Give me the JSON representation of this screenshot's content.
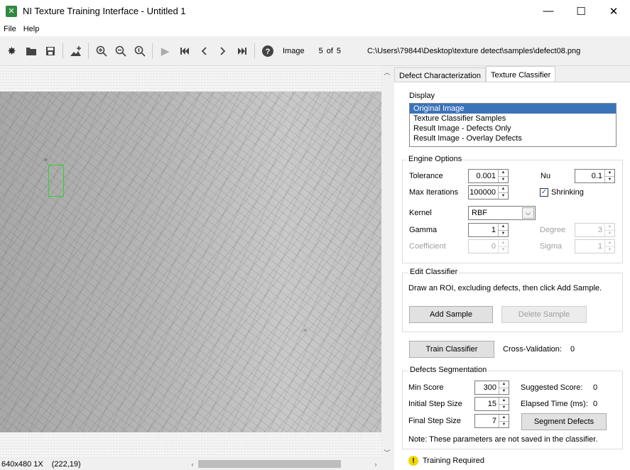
{
  "window": {
    "title": "NI Texture Training Interface - Untitled 1",
    "minimize": "—",
    "maximize": "☐",
    "close": "✕"
  },
  "menu": {
    "items": [
      {
        "label": "File"
      },
      {
        "label": "Help"
      }
    ]
  },
  "toolbar": {
    "image_label": "Image",
    "image_index": "5",
    "of_text": "of",
    "image_count": "5",
    "file_path": "C:\\Users\\79844\\Desktop\\texture detect\\samples\\defect08.png"
  },
  "status": {
    "image_info": "640x480 1X",
    "coords": "(222,19)"
  },
  "tabs": [
    {
      "label": "Defect Characterization",
      "active": false
    },
    {
      "label": "Texture Classifier",
      "active": true
    }
  ],
  "display": {
    "section_label": "Display",
    "options": [
      "Original Image",
      "Texture Classifier Samples",
      "Result Image - Defects Only",
      "Result Image - Overlay Defects"
    ],
    "selected": "Original Image"
  },
  "engine": {
    "section_label": "Engine Options",
    "tolerance_label": "Tolerance",
    "tolerance": "0.001",
    "nu_label": "Nu",
    "nu": "0.1",
    "max_iterations_label": "Max Iterations",
    "max_iterations": "100000",
    "shrinking_label": "Shrinking",
    "shrinking_checked": true,
    "kernel_label": "Kernel",
    "kernel": "RBF",
    "gamma_label": "Gamma",
    "gamma": "1",
    "degree_label": "Degree",
    "degree": "3",
    "coefficient_label": "Coefficient",
    "coefficient": "0",
    "sigma_label": "Sigma",
    "sigma": "1"
  },
  "edit_classifier": {
    "section_label": "Edit Classifier",
    "instruction": "Draw an ROI, excluding defects, then click Add Sample.",
    "add_sample": "Add  Sample",
    "delete_sample": "Delete Sample"
  },
  "training": {
    "train_button": "Train Classifier",
    "cross_validation_label": "Cross-Validation:",
    "cross_validation": "0"
  },
  "segmentation": {
    "section_label": "Defects Segmentation",
    "min_score_label": "Min Score",
    "min_score": "300",
    "suggested_score_label": "Suggested Score:",
    "suggested_score": "0",
    "initial_step_label": "Initial Step Size",
    "initial_step": "15",
    "elapsed_label": "Elapsed Time (ms):",
    "elapsed": "0",
    "final_step_label": "Final Step Size",
    "final_step": "7",
    "segment_button": "Segment Defects",
    "note": "Note: These parameters are not saved in the classifier."
  },
  "footer": {
    "warning": "Training Required"
  },
  "colors": {
    "selection": "#3b73b9",
    "roi": "#2bd52b",
    "warning": "#f2d600",
    "app_icon": "#2d8a3f"
  }
}
